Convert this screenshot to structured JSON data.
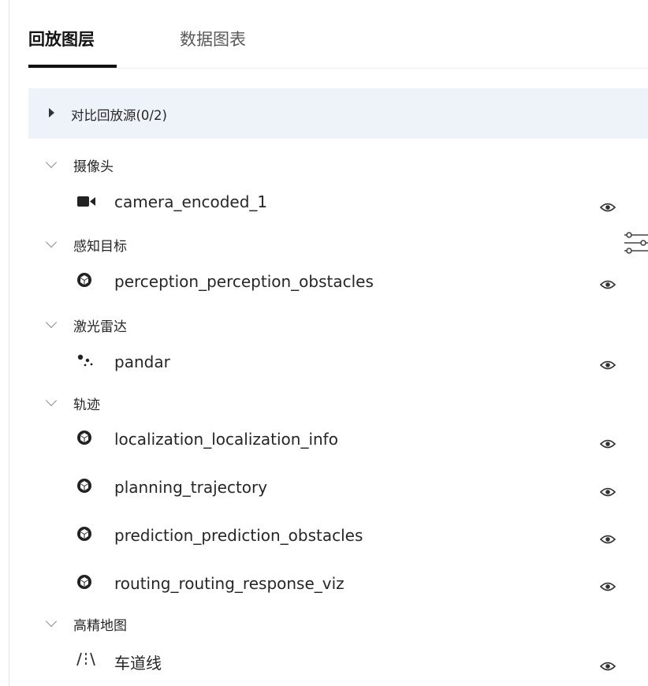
{
  "tabs": [
    {
      "label": "回放图层",
      "active": true
    },
    {
      "label": "数据图表",
      "active": false
    }
  ],
  "compare_source": {
    "label": "对比回放源(0/2)",
    "expanded": false
  },
  "groups": [
    {
      "title": "摄像头",
      "expanded": true,
      "layers": [
        {
          "name": "camera_encoded_1",
          "icon": "video-camera-icon",
          "visible": true
        }
      ]
    },
    {
      "title": "感知目标",
      "expanded": true,
      "layers": [
        {
          "name": "perception_perception_obstacles",
          "icon": "cube-icon",
          "visible": true
        }
      ]
    },
    {
      "title": "激光雷达",
      "expanded": true,
      "layers": [
        {
          "name": "pandar",
          "icon": "point-cloud-icon",
          "visible": true
        }
      ]
    },
    {
      "title": "轨迹",
      "expanded": true,
      "layers": [
        {
          "name": "localization_localization_info",
          "icon": "cube-icon",
          "visible": true
        },
        {
          "name": "planning_trajectory",
          "icon": "cube-icon",
          "visible": true
        },
        {
          "name": "prediction_prediction_obstacles",
          "icon": "cube-icon",
          "visible": true
        },
        {
          "name": "routing_routing_response_viz",
          "icon": "cube-icon",
          "visible": true
        }
      ]
    },
    {
      "title": "高精地图",
      "expanded": true,
      "layers": [
        {
          "name": "车道线",
          "icon": "lane-lines-icon",
          "visible": true
        }
      ]
    }
  ],
  "side_icon": "filter-settings-icon",
  "colors": {
    "active_tab": "#141414",
    "source_bg": "#eef3fa",
    "text": "#262626",
    "muted": "#8c8c8c"
  }
}
